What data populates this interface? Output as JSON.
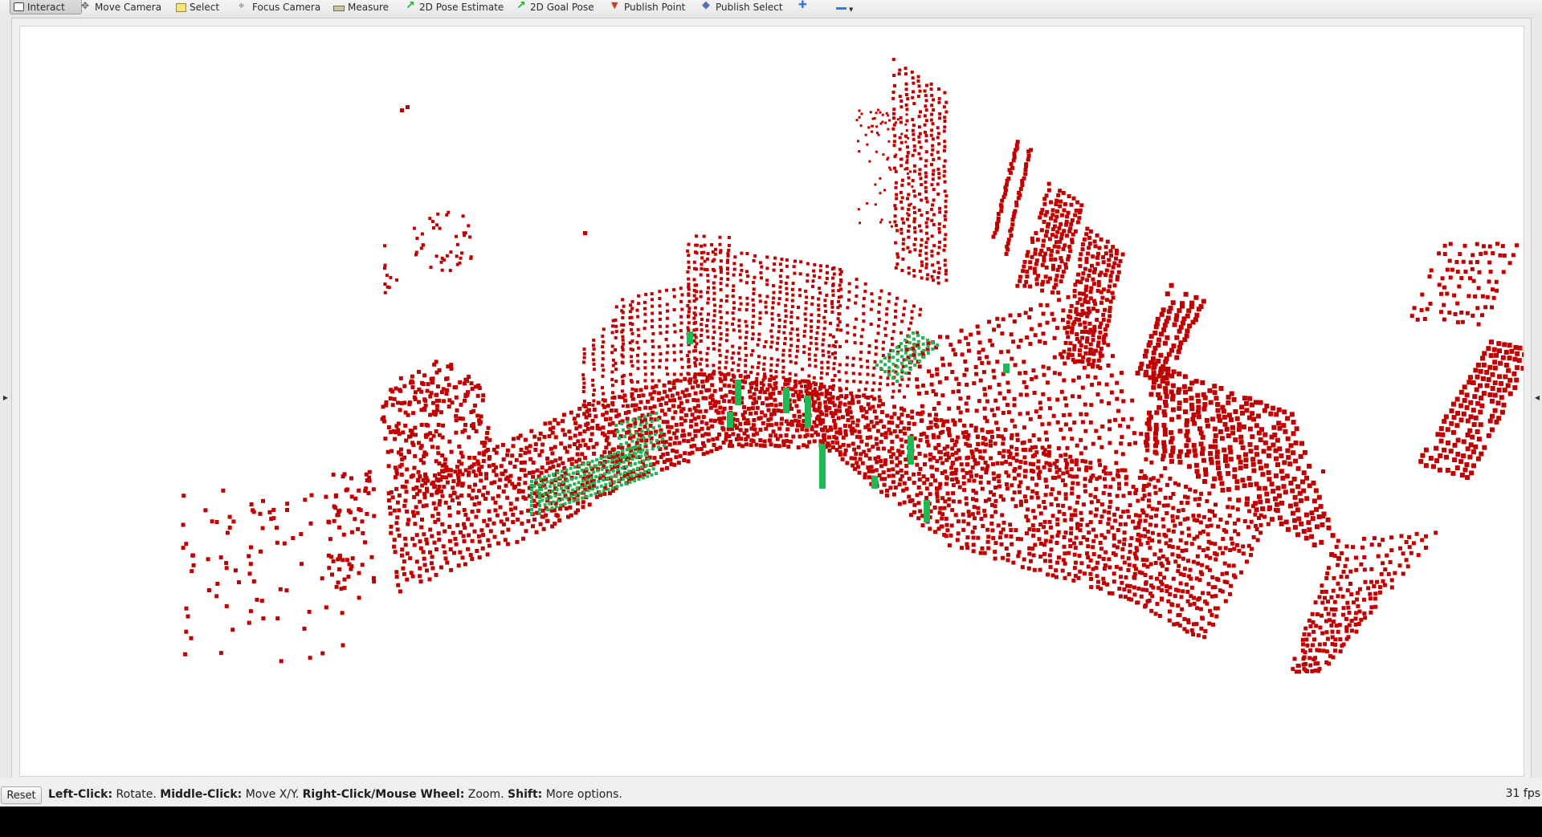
{
  "toolbar": {
    "tools": [
      {
        "label": "Interact",
        "icon": "interact-icon",
        "active": true
      },
      {
        "label": "Move Camera",
        "icon": "move-camera-icon"
      },
      {
        "label": "Select",
        "icon": "select-icon"
      },
      {
        "label": "Focus Camera",
        "icon": "focus-camera-icon"
      },
      {
        "label": "Measure",
        "icon": "measure-icon"
      },
      {
        "label": "2D Pose Estimate",
        "icon": "green-arrow-icon"
      },
      {
        "label": "2D Goal Pose",
        "icon": "green-arrow-icon"
      },
      {
        "label": "Publish Point",
        "icon": "red-pin-icon"
      },
      {
        "label": "Publish Select",
        "icon": "publish-select-icon"
      }
    ],
    "add_tool_icon": "plus-icon",
    "remove_tool_icon": "minus-icon"
  },
  "viewport": {
    "background": "#ffffff",
    "pointcloud_color": "#c00000",
    "marker_color": "#1db954"
  },
  "statusbar": {
    "reset_label": "Reset",
    "hint": [
      {
        "key": "Left-Click:",
        "text": " Rotate. "
      },
      {
        "key": "Middle-Click:",
        "text": " Move X/Y. "
      },
      {
        "key": "Right-Click/Mouse Wheel:",
        "text": " Zoom. "
      },
      {
        "key": "Shift:",
        "text": " More options."
      }
    ],
    "fps": "31 fps"
  }
}
